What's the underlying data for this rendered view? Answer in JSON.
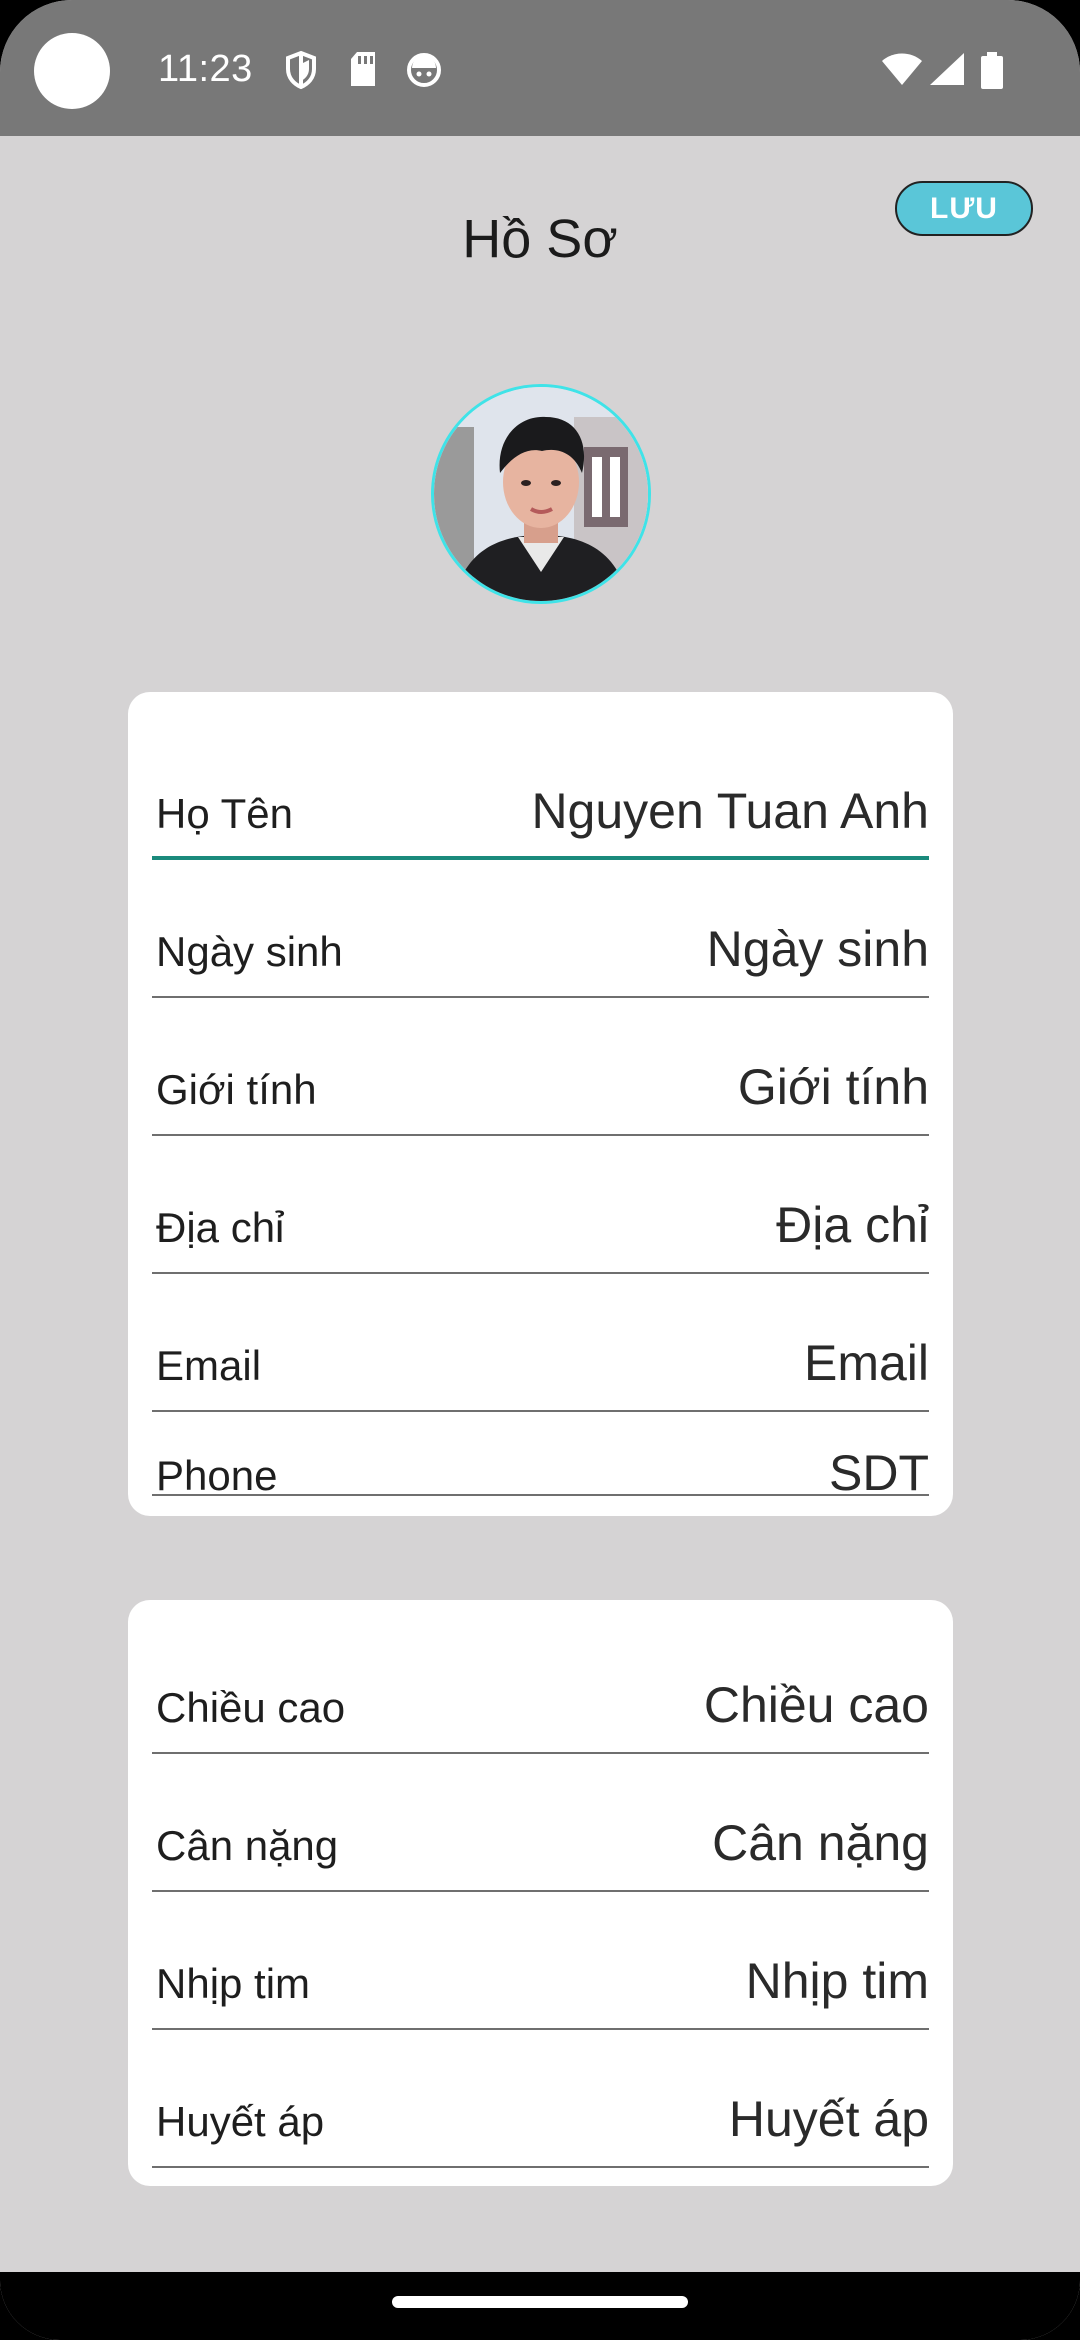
{
  "status_bar": {
    "time": "11:23",
    "icons": [
      "shield-icon",
      "sd-card-icon",
      "robot-icon"
    ],
    "system_icons": [
      "wifi-icon",
      "signal-icon",
      "battery-icon"
    ]
  },
  "header": {
    "title": "Hồ Sơ",
    "save_label": "LƯU"
  },
  "avatar": {
    "alt": "profile-photo"
  },
  "personal_info": {
    "rows": [
      {
        "label": "Họ Tên",
        "value": "Nguyen Tuan Anh"
      },
      {
        "label": "Ngày sinh",
        "value": "Ngày sinh"
      },
      {
        "label": "Giới tính",
        "value": "Giới tính"
      },
      {
        "label": "Địa chỉ",
        "value": "Địa chỉ"
      },
      {
        "label": "Email",
        "value": "Email"
      },
      {
        "label": "Phone",
        "value": "SDT"
      }
    ]
  },
  "health_info": {
    "rows": [
      {
        "label": "Chiều cao",
        "value": "Chiều cao"
      },
      {
        "label": "Cân nặng",
        "value": "Cân nặng"
      },
      {
        "label": "Nhịp tim",
        "value": "Nhịp tim"
      },
      {
        "label": "Huyết áp",
        "value": "Huyết áp"
      }
    ]
  },
  "colors": {
    "accent_underline": "#1a8a7c",
    "save_button": "#5ac6d8",
    "avatar_ring": "#3fe3e8",
    "background": "#d5d3d4"
  }
}
